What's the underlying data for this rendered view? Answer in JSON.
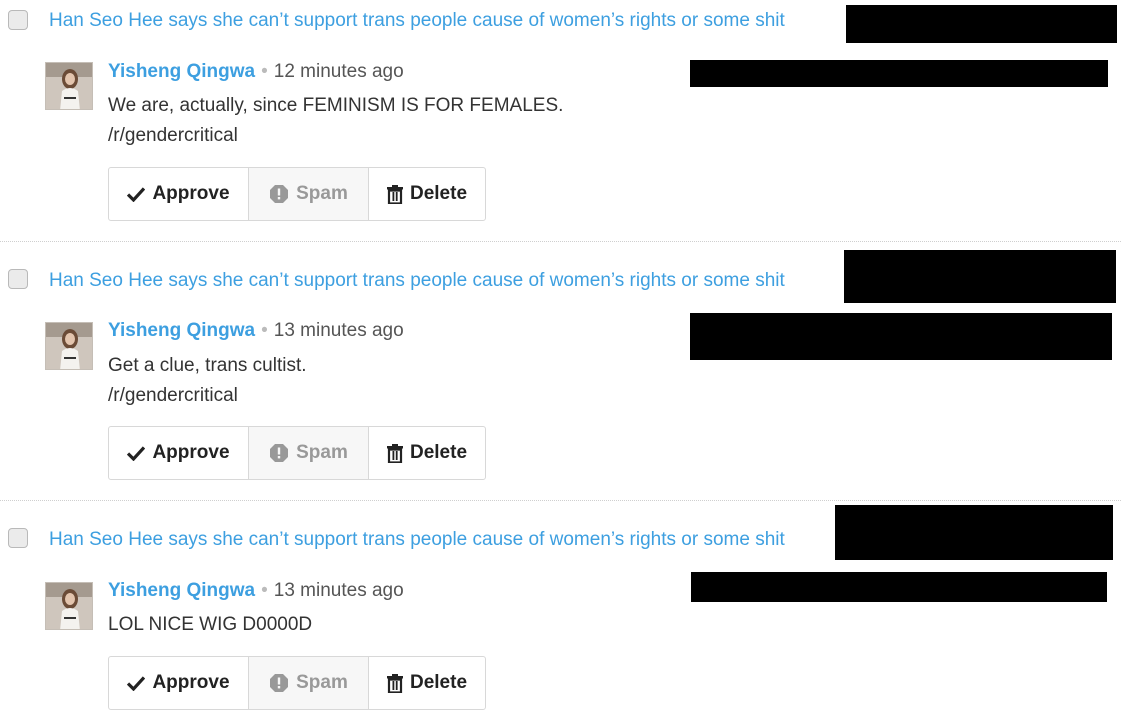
{
  "items": [
    {
      "post_title": "Han Seo Hee says she can’t support trans people cause of women’s rights or some shit",
      "author": "Yisheng Qingwa",
      "separator": "•",
      "time": "12 minutes ago",
      "body": [
        "We are, actually, since FEMINISM IS FOR FEMALES.",
        "/r/gendercritical"
      ]
    },
    {
      "post_title": "Han Seo Hee says she can’t support trans people cause of women’s rights or some shit",
      "author": "Yisheng Qingwa",
      "separator": "•",
      "time": "13 minutes ago",
      "body": [
        "Get a clue, trans cultist.",
        "/r/gendercritical"
      ]
    },
    {
      "post_title": "Han Seo Hee says she can’t support trans people cause of women’s rights or some shit",
      "author": "Yisheng Qingwa",
      "separator": "•",
      "time": "13 minutes ago",
      "body": [
        "LOL NICE WIG D0000D"
      ]
    }
  ],
  "actions": {
    "approve_label": "Approve",
    "spam_label": "Spam",
    "delete_label": "Delete",
    "approve_icon": "check-icon",
    "spam_icon": "exclamation-octagon-icon",
    "delete_icon": "trash-icon"
  },
  "colors": {
    "link": "#3d9fe0",
    "text": "#333333",
    "muted": "#999999",
    "redaction": "#000000"
  }
}
